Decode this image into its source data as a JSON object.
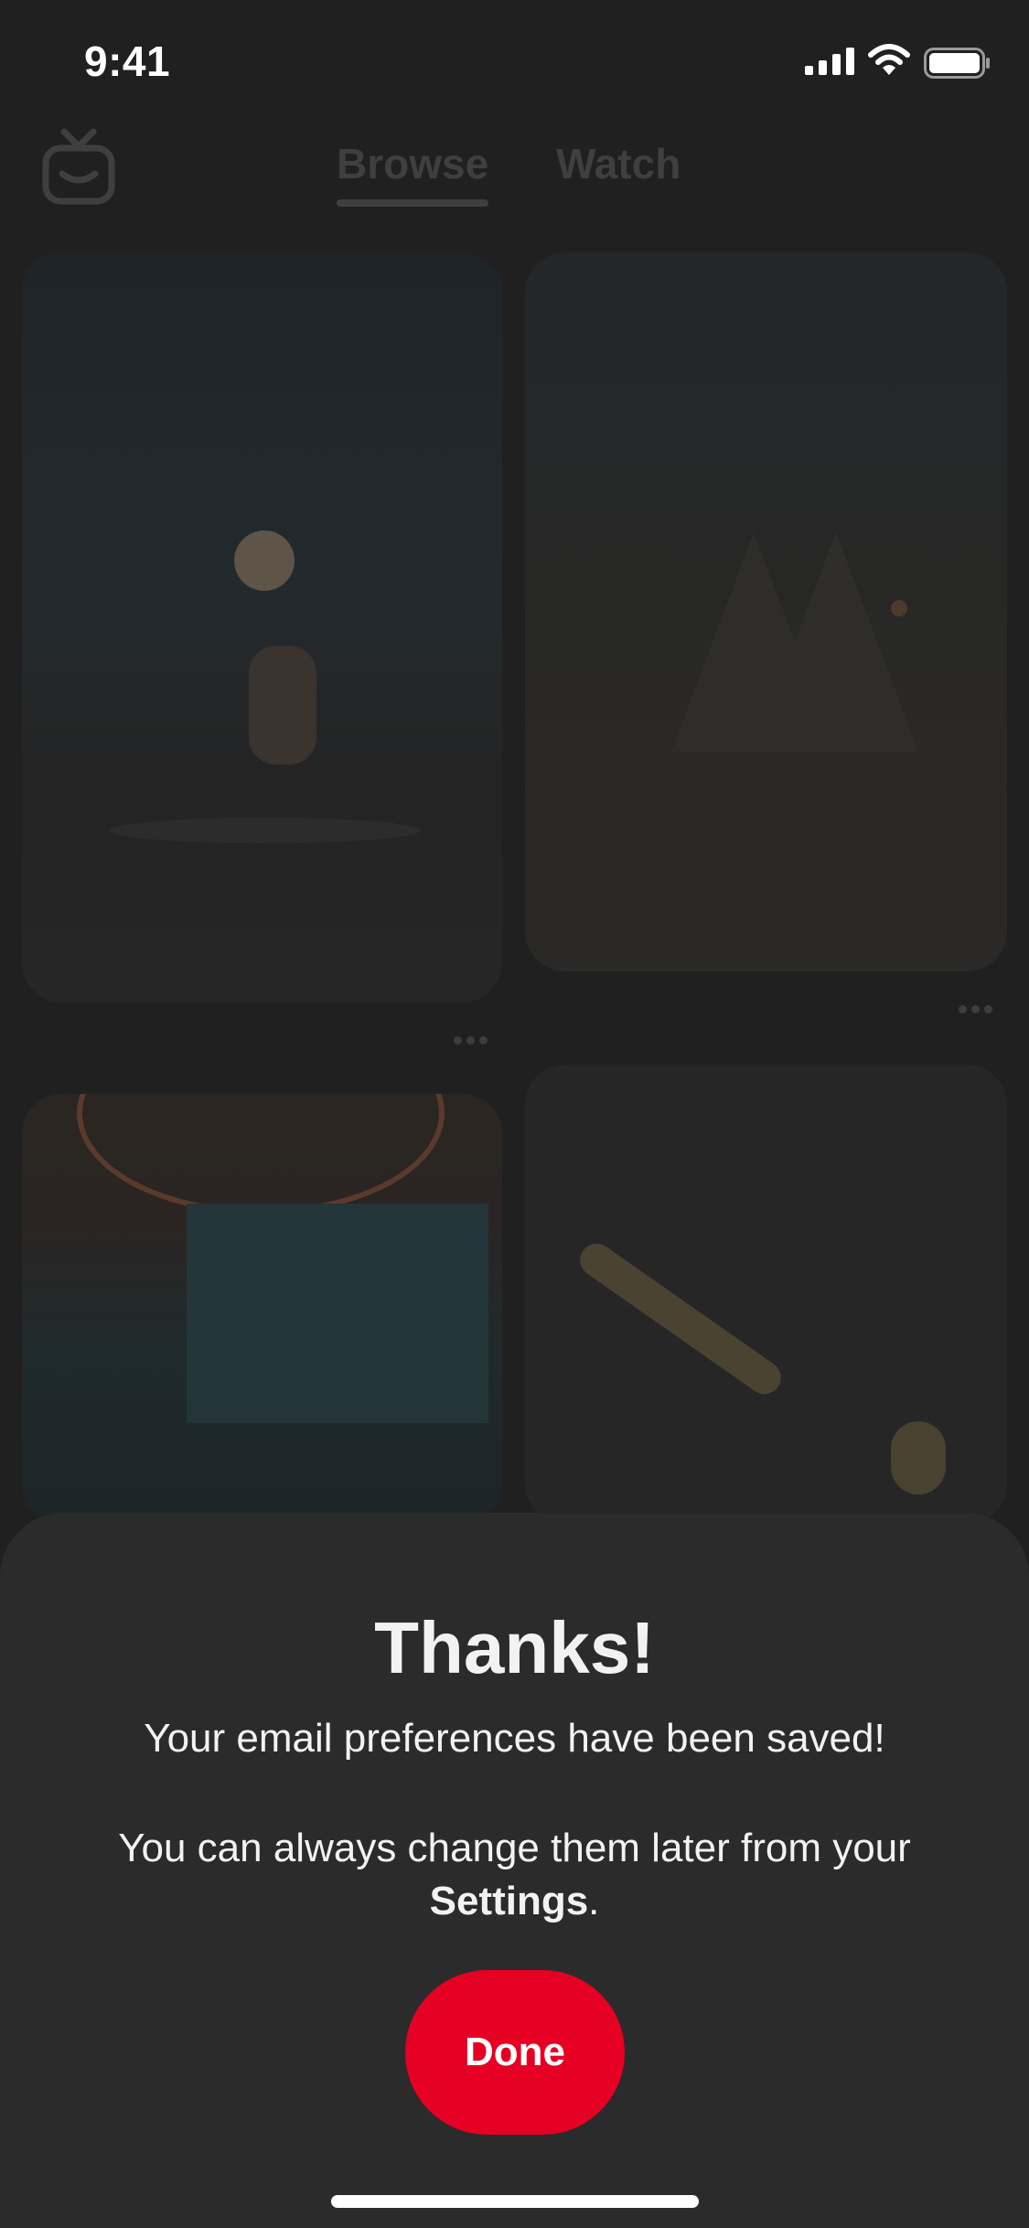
{
  "status_bar": {
    "time": "9:41",
    "icons": [
      "signal-icon",
      "wifi-icon",
      "battery-icon"
    ]
  },
  "header": {
    "logo_icon": "tv-logo-icon",
    "tabs": [
      {
        "label": "Browse",
        "active": true
      },
      {
        "label": "Watch",
        "active": false
      }
    ]
  },
  "feed": {
    "more_icon": "more-horizontal-icon"
  },
  "sheet": {
    "title": "Thanks!",
    "message": "Your email preferences have been saved!",
    "note_prefix": "You can always change them later from your ",
    "note_link": "Settings",
    "note_suffix": ".",
    "done_label": "Done"
  },
  "colors": {
    "accent": "#e60023",
    "sheet_background": "#2b2b2b",
    "dimmed_background": "#202020"
  }
}
